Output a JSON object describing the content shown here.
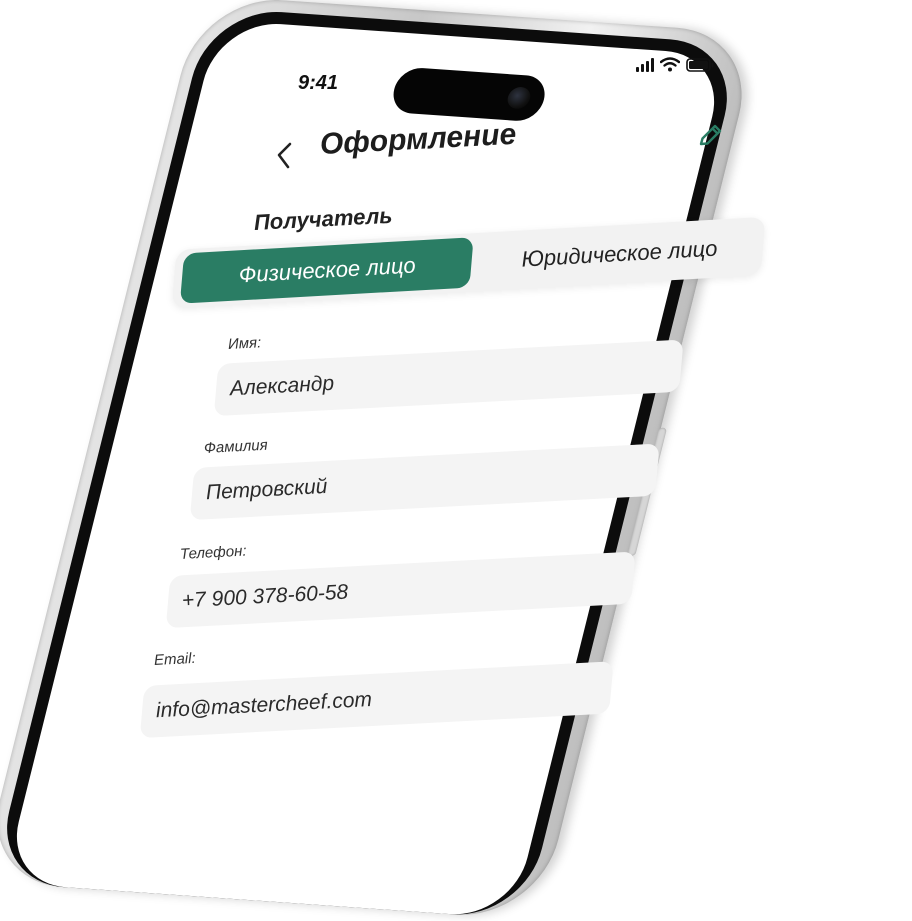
{
  "status_bar": {
    "time": "9:41",
    "signal_icon": "cellular-signal-icon",
    "wifi_icon": "wifi-icon",
    "battery_icon": "battery-icon"
  },
  "header": {
    "back_icon": "chevron-left-icon",
    "title": "Оформление",
    "edit_icon": "pencil-icon",
    "accent_color": "#2a7d64"
  },
  "recipient": {
    "section_label": "Получатель",
    "tabs": [
      {
        "label": "Физическое лицо",
        "active": true
      },
      {
        "label": "Юридическое лицо",
        "active": false
      }
    ]
  },
  "form": {
    "fields": [
      {
        "label": "Имя:",
        "value": "Александр"
      },
      {
        "label": "Фамилия",
        "value": "Петровский"
      },
      {
        "label": "Телефон:",
        "value": "+7 900 378-60-58"
      },
      {
        "label": "Email:",
        "value": "info@mastercheef.com"
      }
    ]
  }
}
